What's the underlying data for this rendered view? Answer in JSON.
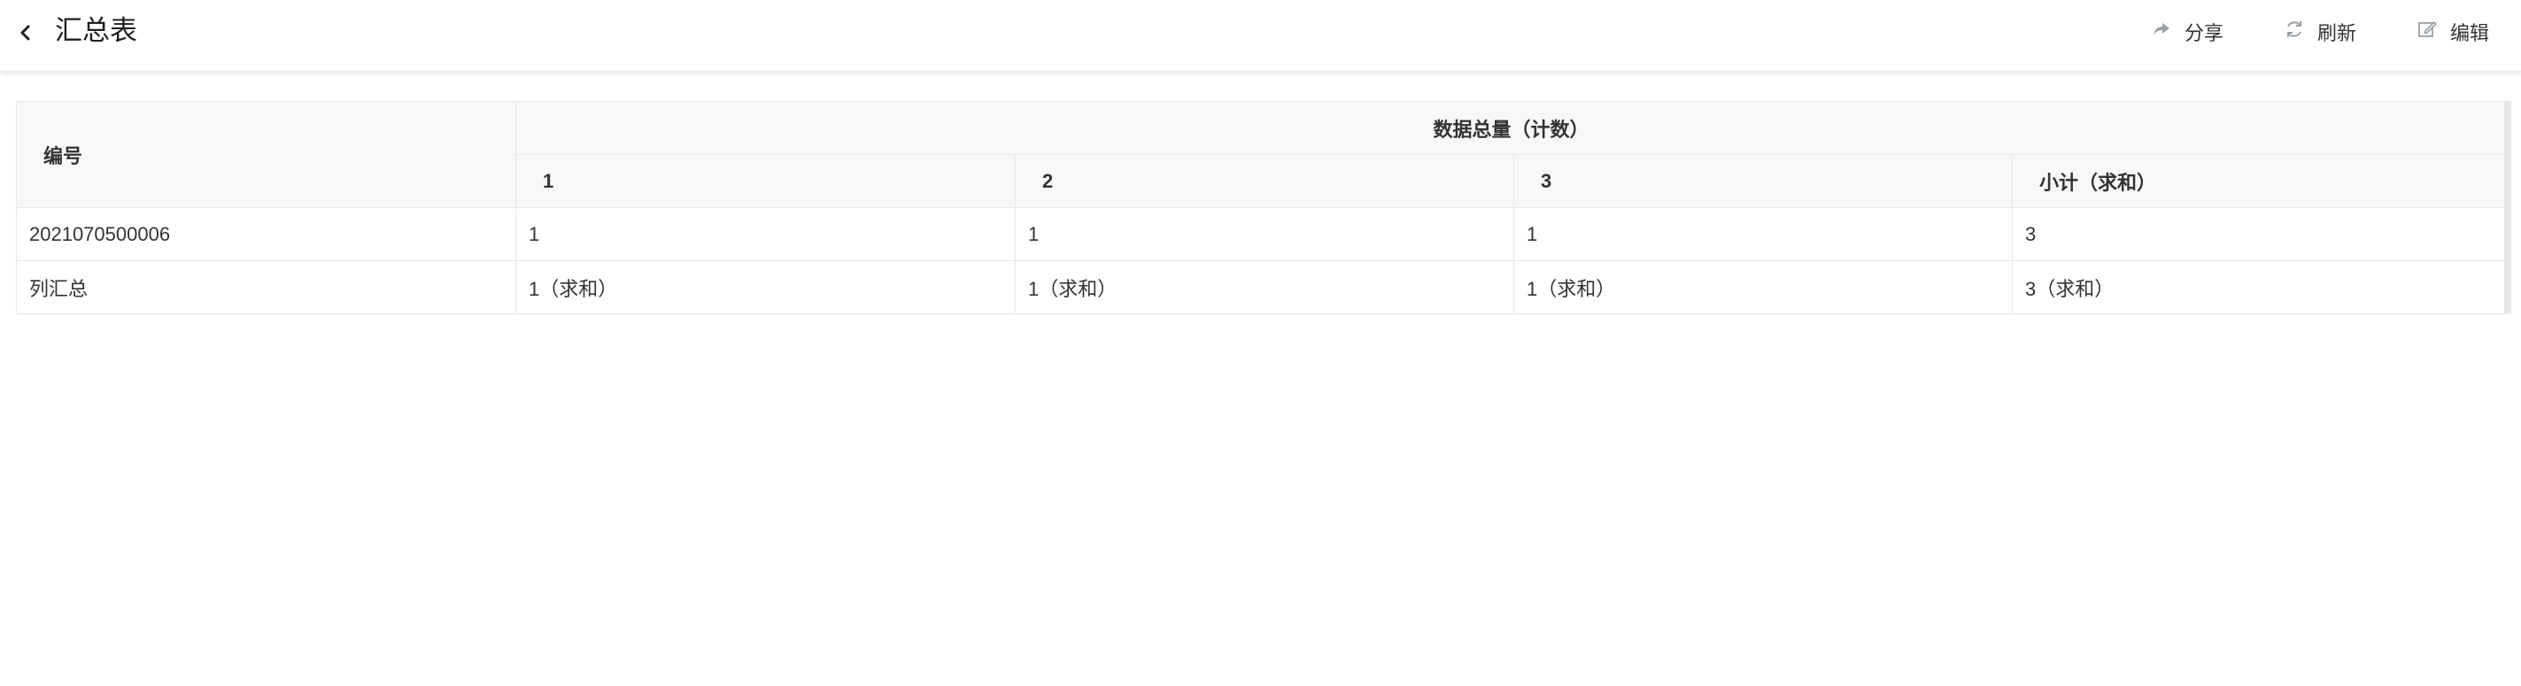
{
  "header": {
    "title": "汇总表",
    "actions": {
      "share": "分享",
      "refresh": "刷新",
      "edit": "编辑"
    }
  },
  "table": {
    "row_header_label": "编号",
    "group_header": "数据总量（计数）",
    "columns": [
      "1",
      "2",
      "3",
      "小计（求和）"
    ],
    "rows": [
      {
        "label": "2021070500006",
        "values": [
          "1",
          "1",
          "1",
          "3"
        ]
      },
      {
        "label": "列汇总",
        "values": [
          "1（求和）",
          "1（求和）",
          "1（求和）",
          "3（求和）"
        ]
      }
    ]
  }
}
